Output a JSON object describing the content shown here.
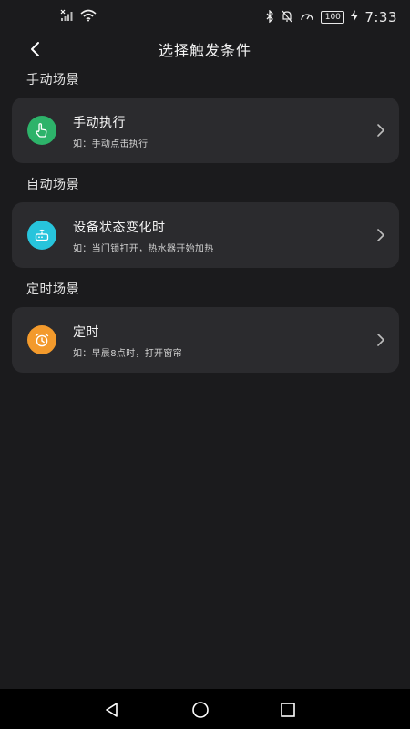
{
  "status_bar": {
    "battery": "100",
    "time": "7:33"
  },
  "header": {
    "title": "选择触发条件"
  },
  "sections": [
    {
      "title": "手动场景",
      "card": {
        "title": "手动执行",
        "desc": "如：手动点击执行",
        "icon": "hand-pointer-icon",
        "color": "#2db36a"
      }
    },
    {
      "title": "自动场景",
      "card": {
        "title": "设备状态变化时",
        "desc": "如：当门锁打开，热水器开始加热",
        "icon": "router-device-icon",
        "color": "#27c4dc"
      }
    },
    {
      "title": "定时场景",
      "card": {
        "title": "定时",
        "desc": "如：早晨8点时，打开窗帘",
        "icon": "alarm-clock-icon",
        "color": "#f39a2c"
      }
    }
  ],
  "colors": {
    "background": "#1b1b1d",
    "card": "#2b2b2e",
    "nav": "#000000"
  }
}
